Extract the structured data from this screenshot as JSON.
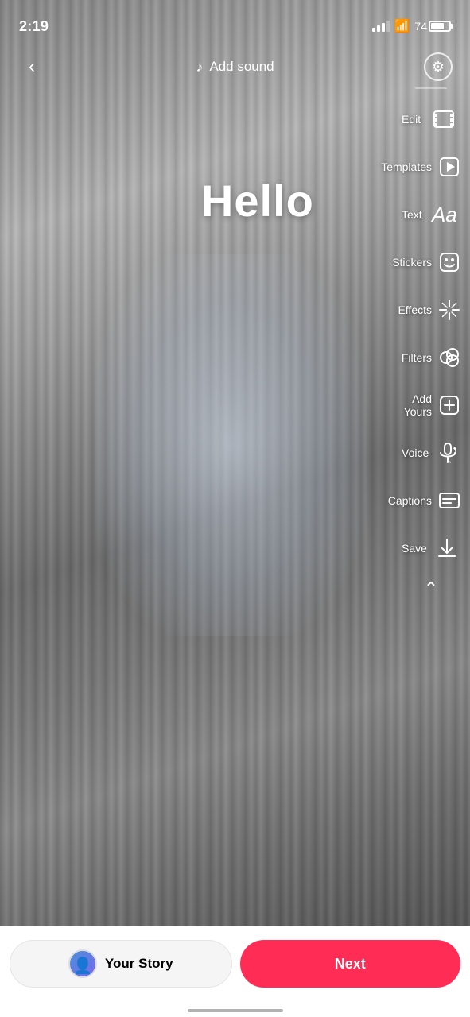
{
  "statusBar": {
    "time": "2:19",
    "batteryPercent": "74"
  },
  "topBar": {
    "addSoundLabel": "Add sound",
    "backArrow": "‹"
  },
  "canvas": {
    "helloText": "Hello"
  },
  "toolbar": {
    "items": [
      {
        "id": "edit",
        "label": "Edit",
        "icon": "edit"
      },
      {
        "id": "templates",
        "label": "Templates",
        "icon": "templates"
      },
      {
        "id": "text",
        "label": "Text",
        "icon": "text"
      },
      {
        "id": "stickers",
        "label": "Stickers",
        "icon": "stickers"
      },
      {
        "id": "effects",
        "label": "Effects",
        "icon": "effects"
      },
      {
        "id": "filters",
        "label": "Filters",
        "icon": "filters"
      },
      {
        "id": "add-yours",
        "label": "Add Yours",
        "icon": "add-yours"
      },
      {
        "id": "voice",
        "label": "Voice",
        "icon": "voice"
      },
      {
        "id": "captions",
        "label": "Captions",
        "icon": "captions"
      },
      {
        "id": "save",
        "label": "Save",
        "icon": "save"
      }
    ]
  },
  "bottomBar": {
    "yourStoryLabel": "Your Story",
    "nextLabel": "Next"
  }
}
